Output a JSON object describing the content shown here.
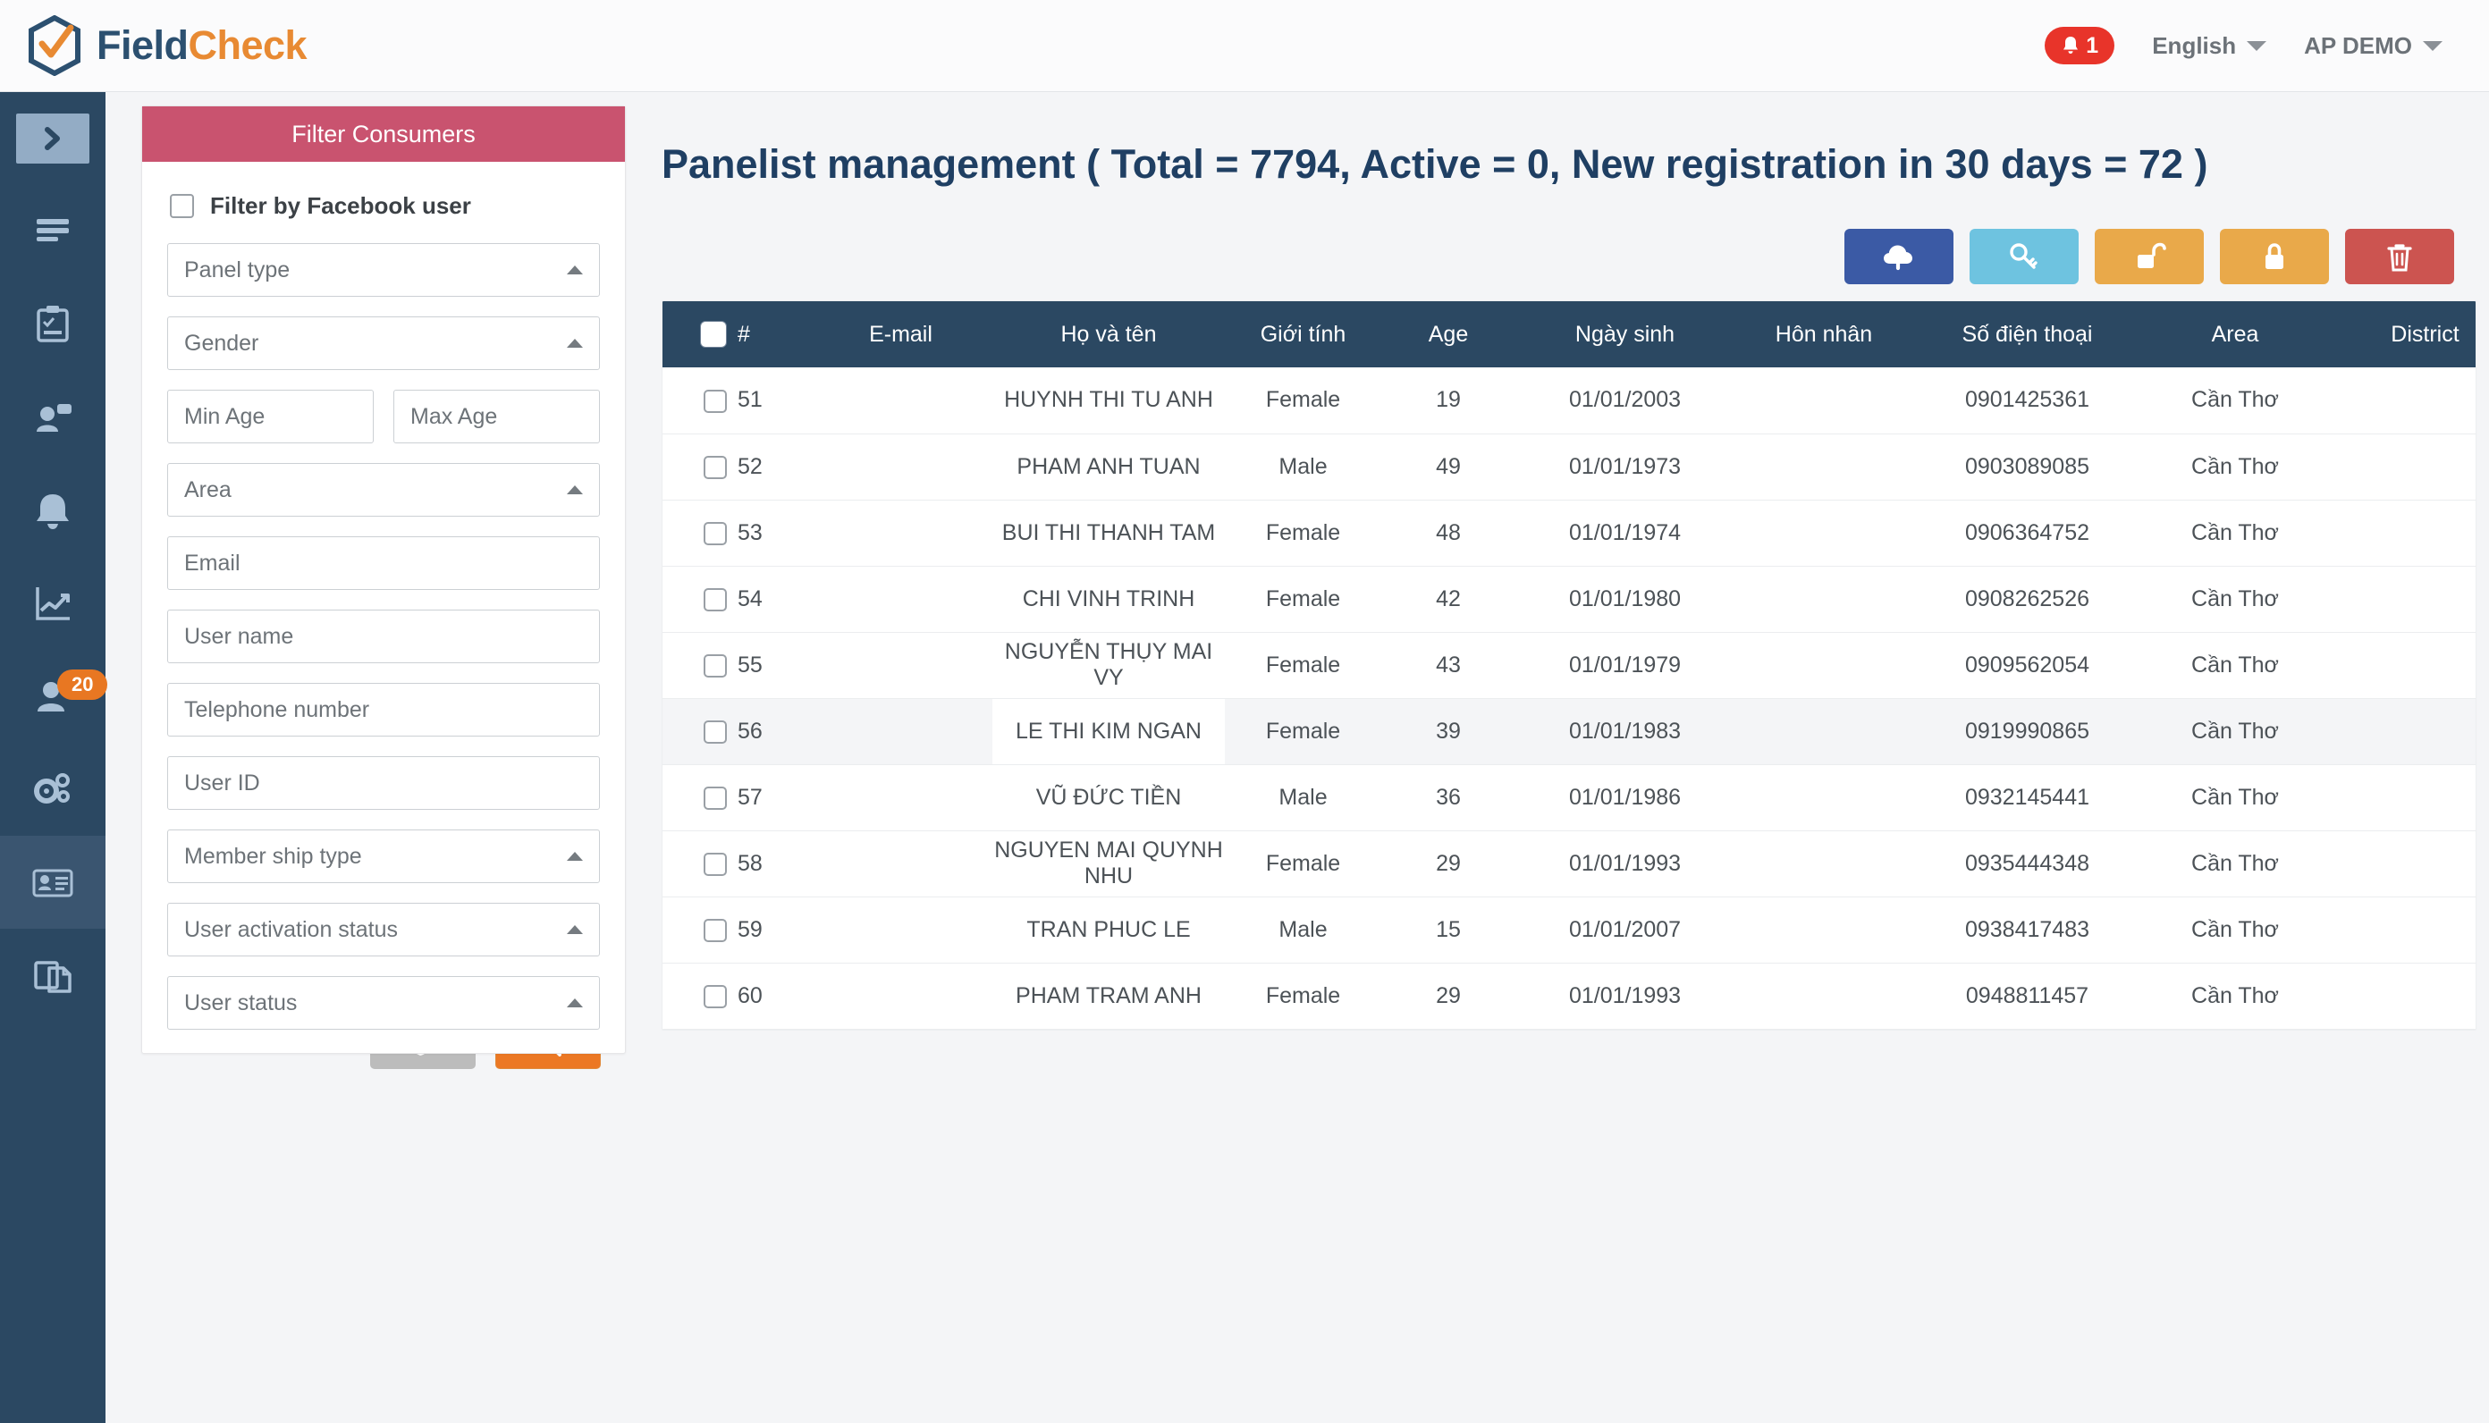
{
  "topbar": {
    "brand_first": "Field",
    "brand_second": "Check",
    "notification_count": "1",
    "language": "English",
    "account": "AP DEMO"
  },
  "sidebar": {
    "items": [
      {
        "icon": "chevron-right-toggle-icon",
        "badge": null,
        "active": false
      },
      {
        "icon": "list-menu-icon",
        "badge": null,
        "active": false
      },
      {
        "icon": "clipboard-check-icon",
        "badge": null,
        "active": false
      },
      {
        "icon": "user-message-icon",
        "badge": null,
        "active": false
      },
      {
        "icon": "bell-icon",
        "badge": null,
        "active": false
      },
      {
        "icon": "chart-line-icon",
        "badge": null,
        "active": false
      },
      {
        "icon": "users-icon",
        "badge": "20",
        "active": false
      },
      {
        "icon": "gears-icon",
        "badge": null,
        "active": false
      },
      {
        "icon": "id-card-icon",
        "badge": null,
        "active": true
      },
      {
        "icon": "documents-icon",
        "badge": null,
        "active": false
      }
    ]
  },
  "filter": {
    "title": "Filter Consumers",
    "facebook_checkbox_label": "Filter by Facebook user",
    "fields": [
      {
        "name": "panel-type",
        "placeholder": "Panel type",
        "value": "",
        "type": "select"
      },
      {
        "name": "gender",
        "placeholder": "Gender",
        "value": "",
        "type": "select"
      },
      {
        "name": "min-age",
        "placeholder": "Min Age",
        "value": "",
        "type": "text"
      },
      {
        "name": "max-age",
        "placeholder": "Max Age",
        "value": "",
        "type": "text"
      },
      {
        "name": "area",
        "placeholder": "Area",
        "value": "",
        "type": "select"
      },
      {
        "name": "email",
        "placeholder": "Email",
        "value": "",
        "type": "text"
      },
      {
        "name": "user-name",
        "placeholder": "User name",
        "value": "",
        "type": "text"
      },
      {
        "name": "telephone-number",
        "placeholder": "Telephone number",
        "value": "",
        "type": "text"
      },
      {
        "name": "user-id",
        "placeholder": "User ID",
        "value": "",
        "type": "text"
      },
      {
        "name": "member-ship-type",
        "placeholder": "Member ship type",
        "value": "",
        "type": "select"
      },
      {
        "name": "user-activation-status",
        "placeholder": "User activation status",
        "value": "",
        "type": "select"
      },
      {
        "name": "user-status",
        "placeholder": "User status",
        "value": "",
        "type": "select"
      }
    ],
    "clear_icon": "broom-icon",
    "search_icon": "magnifier-icon"
  },
  "main": {
    "page_title": "Panelist management ( Total = 7794, Active = 0, New registration in 30 days = 72 )",
    "stats": {
      "total": "7794",
      "active": "0",
      "new_registration_30_days": "72"
    },
    "actions": [
      {
        "name": "upload-button",
        "icon": "cloud-upload-icon",
        "color": "#3b5aa5"
      },
      {
        "name": "reset-password-button",
        "icon": "key-icon",
        "color": "#6ec3e0"
      },
      {
        "name": "unlock-button",
        "icon": "unlock-icon",
        "color": "#e9a94a"
      },
      {
        "name": "lock-button",
        "icon": "lock-icon",
        "color": "#e9a94a"
      },
      {
        "name": "delete-button",
        "icon": "trash-icon",
        "color": "#cc5450"
      }
    ],
    "table": {
      "columns": [
        "#",
        "E-mail",
        "Họ và tên",
        "Giới tính",
        "Age",
        "Ngày sinh",
        "Hôn nhân",
        "Số điện thoại",
        "Area",
        "District"
      ],
      "rows": [
        {
          "num": "51",
          "email": "",
          "name": "HUYNH THI TU ANH",
          "gender": "Female",
          "age": "19",
          "dob": "01/01/2003",
          "marital": "",
          "phone": "0901425361",
          "area": "Cần Thơ",
          "district": "",
          "hover": false
        },
        {
          "num": "52",
          "email": "",
          "name": "PHAM ANH TUAN",
          "gender": "Male",
          "age": "49",
          "dob": "01/01/1973",
          "marital": "",
          "phone": "0903089085",
          "area": "Cần Thơ",
          "district": "",
          "hover": false
        },
        {
          "num": "53",
          "email": "",
          "name": "BUI THI THANH TAM",
          "gender": "Female",
          "age": "48",
          "dob": "01/01/1974",
          "marital": "",
          "phone": "0906364752",
          "area": "Cần Thơ",
          "district": "",
          "hover": false
        },
        {
          "num": "54",
          "email": "",
          "name": "CHI VINH TRINH",
          "gender": "Female",
          "age": "42",
          "dob": "01/01/1980",
          "marital": "",
          "phone": "0908262526",
          "area": "Cần Thơ",
          "district": "",
          "hover": false
        },
        {
          "num": "55",
          "email": "",
          "name": "NGUYỄN THỤY MAI VY",
          "gender": "Female",
          "age": "43",
          "dob": "01/01/1979",
          "marital": "",
          "phone": "0909562054",
          "area": "Cần Thơ",
          "district": "",
          "hover": false
        },
        {
          "num": "56",
          "email": "",
          "name": "LE THI KIM NGAN",
          "gender": "Female",
          "age": "39",
          "dob": "01/01/1983",
          "marital": "",
          "phone": "0919990865",
          "area": "Cần Thơ",
          "district": "",
          "hover": true
        },
        {
          "num": "57",
          "email": "",
          "name": "VŨ ĐỨC TIỀN",
          "gender": "Male",
          "age": "36",
          "dob": "01/01/1986",
          "marital": "",
          "phone": "0932145441",
          "area": "Cần Thơ",
          "district": "",
          "hover": false
        },
        {
          "num": "58",
          "email": "",
          "name": "NGUYEN MAI QUYNH NHU",
          "gender": "Female",
          "age": "29",
          "dob": "01/01/1993",
          "marital": "",
          "phone": "0935444348",
          "area": "Cần Thơ",
          "district": "",
          "hover": false
        },
        {
          "num": "59",
          "email": "",
          "name": "TRAN PHUC LE",
          "gender": "Male",
          "age": "15",
          "dob": "01/01/2007",
          "marital": "",
          "phone": "0938417483",
          "area": "Cần Thơ",
          "district": "",
          "hover": false
        },
        {
          "num": "60",
          "email": "",
          "name": "PHAM TRAM ANH",
          "gender": "Female",
          "age": "29",
          "dob": "01/01/1993",
          "marital": "",
          "phone": "0948811457",
          "area": "Cần Thơ",
          "district": "",
          "hover": false
        }
      ]
    }
  },
  "colors": {
    "sidebar": "#2b4862",
    "filter_header": "#c9536f",
    "accent_orange": "#ec7824",
    "table_header": "#2b4862",
    "badge_red": "#e8342a",
    "badge_orange": "#e87722"
  }
}
